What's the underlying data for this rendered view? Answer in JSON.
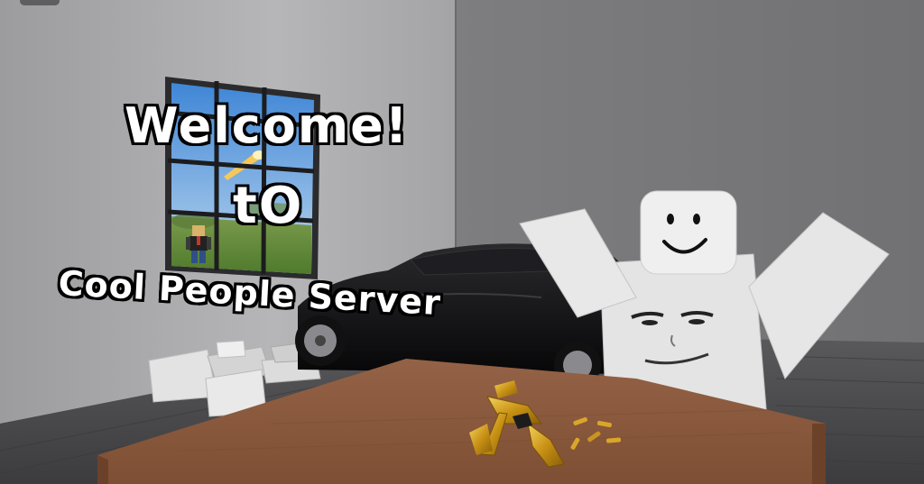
{
  "scene": {
    "caption": {
      "line1": "Welcome!",
      "line2": "tO",
      "line3": "Cool People Server"
    }
  },
  "colors": {
    "wall_left": "#aeaeb0",
    "wall_back": "#7a7a7c",
    "floor": "#4a4a4c",
    "table_top": "#8a5a3c",
    "table_side": "#6b4229",
    "car": "#0e0e10",
    "avatar_white": "#e6e6e6",
    "gun_gold": "#d9a62a"
  },
  "icons": {
    "window": "window-with-landscape",
    "car": "black-sedan",
    "character": "blocky-avatar-waving",
    "weapon": "gold-smg-icon",
    "ammo": "bullet-casings"
  }
}
